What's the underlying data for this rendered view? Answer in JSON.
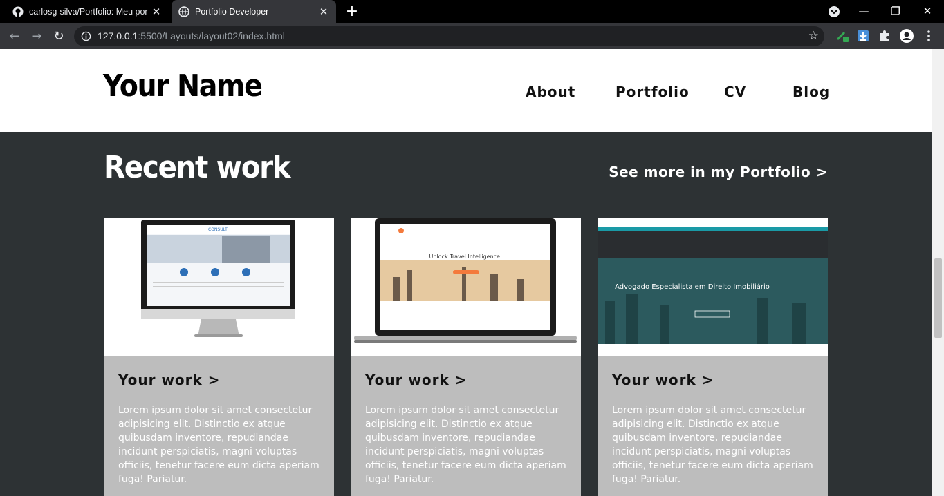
{
  "browser": {
    "tabs": [
      {
        "title": "carlosg-silva/Portfolio: Meu portf",
        "active": false
      },
      {
        "title": "Portfolio Developer",
        "active": true
      }
    ],
    "url_host": "127.0.0.1",
    "url_path": ":5500/Layouts/layout02/index.html"
  },
  "header": {
    "logo": "Your Name",
    "nav": [
      "About",
      "Portfolio",
      "CV",
      "Blog"
    ]
  },
  "work": {
    "title": "Recent work",
    "see_more": "See more in my Portfolio >",
    "cards": [
      {
        "title": "Your work >",
        "text": "Lorem ipsum dolor sit amet consectetur adipisicing elit. Distinctio ex atque quibusdam inventore, repudiandae incidunt perspiciatis, magni voluptas officiis, tenetur facere eum dicta aperiam fuga! Pariatur.",
        "thumb_text": "CONSULT"
      },
      {
        "title": "Your work >",
        "text": "Lorem ipsum dolor sit amet consectetur adipisicing elit. Distinctio ex atque quibusdam inventore, repudiandae incidunt perspiciatis, magni voluptas officiis, tenetur facere eum dicta aperiam fuga! Pariatur.",
        "thumb_text": "Unlock Travel Intelligence."
      },
      {
        "title": "Your work >",
        "text": "Lorem ipsum dolor sit amet consectetur adipisicing elit. Distinctio ex atque quibusdam inventore, repudiandae incidunt perspiciatis, magni voluptas officiis, tenetur facere eum dicta aperiam fuga! Pariatur.",
        "thumb_text": "Advogado Especialista em Direito Imobiliário"
      }
    ]
  },
  "icons": [
    "github-icon",
    "globe-icon",
    "close-icon",
    "plus-icon",
    "back-icon",
    "forward-icon",
    "reload-icon",
    "info-icon",
    "star-icon",
    "extensions-icon",
    "profile-icon",
    "menu-icon"
  ],
  "colors": {
    "section_bg": "#2d3234",
    "card_bg": "#bdbdbd"
  }
}
